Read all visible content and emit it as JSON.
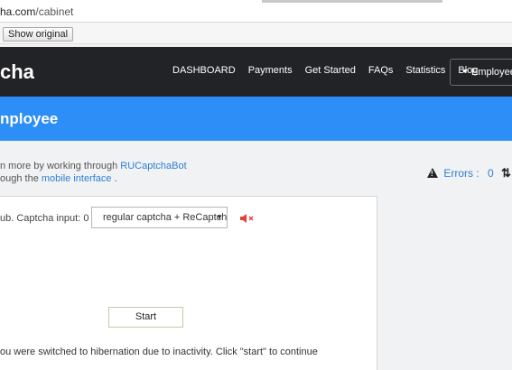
{
  "browser": {
    "url_host": "ha.com",
    "url_path": "/cabinet"
  },
  "translate_bar": {
    "show_original_label": "Show original"
  },
  "navbar": {
    "brand": "cha",
    "links": [
      "DASHBOARD",
      "Payments",
      "Get Started",
      "FAQs",
      "Statistics",
      "Blog"
    ],
    "employee_button": "Employee"
  },
  "banner": {
    "title": "nployee"
  },
  "info": {
    "line1_prefix": "n more by working through ",
    "line1_link": "RUCaptchaBot",
    "line2_prefix": "ough the ",
    "line2_link": "mobile interface",
    "line2_suffix": " ."
  },
  "errors": {
    "label": "Errors",
    "separator": ":",
    "count": "0"
  },
  "panel": {
    "sub_text": "ub. Captcha input: 0 .",
    "captcha_select_value": "regular captcha + ReCaptcha",
    "start_label": "Start",
    "hibernate_message": "ou were switched to hibernation due to inactivity. Click \"start\" to continue"
  },
  "icons": {
    "warning": "warning-icon",
    "sort": "sort-icon",
    "mute": "mute-icon",
    "dropdown": "chevron-down-icon"
  },
  "colors": {
    "navbar_bg": "#222326",
    "banner_bg": "#2d8ef7",
    "link": "#2f7fd1",
    "mute_icon": "#e2413b"
  }
}
